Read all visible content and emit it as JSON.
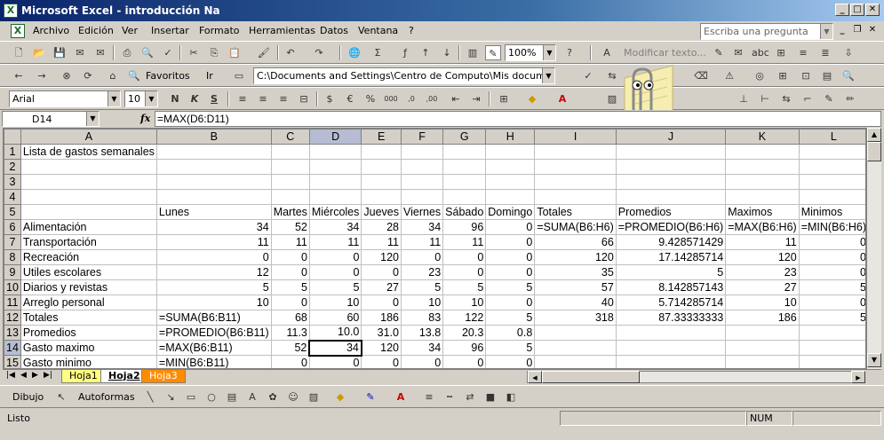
{
  "window": {
    "title": "Microsoft Excel - introducción Na",
    "app_icon": "excel-icon"
  },
  "menu": {
    "items": [
      "Archivo",
      "Edición",
      "Ver",
      "Insertar",
      "Formato",
      "Herramientas",
      "Datos",
      "Ventana",
      "?"
    ],
    "help_placeholder": "Escriba una pregunta"
  },
  "toolbar1": {
    "zoom": "100%",
    "review_text": "Modificar texto..."
  },
  "toolbar2": {
    "favorites": "Favoritos",
    "go": "Ir",
    "address": "C:\\Documents and Settings\\Centro de Computo\\Mis documentos\\in"
  },
  "toolbar3": {
    "font": "Arial",
    "size": "10",
    "bold": "N",
    "italic": "K",
    "underline": "S"
  },
  "formula": {
    "name_box": "D14",
    "fx": "fx",
    "content": "=MAX(D6:D11)"
  },
  "columns": [
    "A",
    "B",
    "C",
    "D",
    "E",
    "F",
    "G",
    "H",
    "I",
    "J",
    "K",
    "L"
  ],
  "selected_col": "D",
  "selected_row": 14,
  "rows": [
    {
      "n": "1",
      "cells": [
        "Lista de gastos semanales",
        "",
        "",
        "",
        "",
        "",
        "",
        "",
        "",
        "",
        "",
        ""
      ]
    },
    {
      "n": "2",
      "cells": [
        "",
        "",
        "",
        "",
        "",
        "",
        "",
        "",
        "",
        "",
        "",
        ""
      ]
    },
    {
      "n": "3",
      "cells": [
        "",
        "",
        "",
        "",
        "",
        "",
        "",
        "",
        "",
        "",
        "",
        ""
      ]
    },
    {
      "n": "4",
      "cells": [
        "",
        "",
        "",
        "",
        "",
        "",
        "",
        "",
        "",
        "",
        "",
        ""
      ]
    },
    {
      "n": "5",
      "cells": [
        "",
        "Lunes",
        "Martes",
        "Miércoles",
        "Jueves",
        "Viernes",
        "Sábado",
        "Domingo",
        "Totales",
        "Promedios",
        "Maximos",
        "Minimos"
      ]
    },
    {
      "n": "6",
      "cells": [
        "Alimentación",
        "34",
        "52",
        "34",
        "28",
        "34",
        "96",
        "0",
        "=SUMA(B6:H6)",
        "=PROMEDIO(B6:H6)",
        "=MAX(B6:H6)",
        "=MIN(B6:H6)"
      ]
    },
    {
      "n": "7",
      "cells": [
        "Transportación",
        "11",
        "11",
        "11",
        "11",
        "11",
        "11",
        "0",
        "66",
        "9.428571429",
        "11",
        "0"
      ]
    },
    {
      "n": "8",
      "cells": [
        "Recreación",
        "0",
        "0",
        "0",
        "120",
        "0",
        "0",
        "0",
        "120",
        "17.14285714",
        "120",
        "0"
      ]
    },
    {
      "n": "9",
      "cells": [
        "Utiles escolares",
        "12",
        "0",
        "0",
        "0",
        "23",
        "0",
        "0",
        "35",
        "5",
        "23",
        "0"
      ]
    },
    {
      "n": "10",
      "cells": [
        "Diarios y revistas",
        "5",
        "5",
        "5",
        "27",
        "5",
        "5",
        "5",
        "57",
        "8.142857143",
        "27",
        "5"
      ]
    },
    {
      "n": "11",
      "cells": [
        "Arreglo personal",
        "10",
        "0",
        "10",
        "0",
        "10",
        "10",
        "0",
        "40",
        "5.714285714",
        "10",
        "0"
      ]
    },
    {
      "n": "12",
      "cells": [
        "Totales",
        "=SUMA(B6:B11)",
        "68",
        "60",
        "186",
        "83",
        "122",
        "5",
        "318",
        "87.33333333",
        "186",
        "5"
      ]
    },
    {
      "n": "13",
      "cells": [
        "Promedios",
        "=PROMEDIO(B6:B11)",
        "11.3",
        "10.0",
        "31.0",
        "13.8",
        "20.3",
        "0.8",
        "",
        "",
        "",
        ""
      ]
    },
    {
      "n": "14",
      "cells": [
        "Gasto maximo",
        "=MAX(B6:B11)",
        "52",
        "34",
        "120",
        "34",
        "96",
        "5",
        "",
        "",
        "",
        ""
      ]
    },
    {
      "n": "15",
      "cells": [
        "Gasto minimo",
        "=MIN(B6:B11)",
        "0",
        "0",
        "0",
        "0",
        "0",
        "0",
        "",
        "",
        "",
        ""
      ]
    }
  ],
  "sheets": [
    {
      "name": "Hoja1",
      "active": false
    },
    {
      "name": "Hoja2",
      "active": true
    },
    {
      "name": "Hoja3",
      "active": false
    }
  ],
  "drawing": {
    "draw": "Dibujo",
    "autoshapes": "Autoformas"
  },
  "status": {
    "left": "Listo",
    "num": "NUM"
  }
}
